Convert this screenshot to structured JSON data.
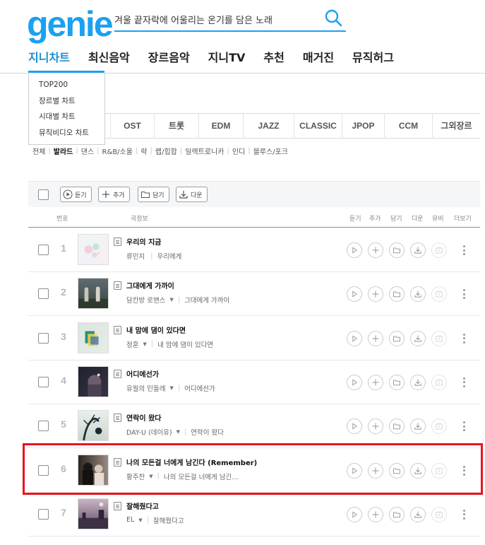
{
  "header": {
    "logo": "genie",
    "search": {
      "value": "겨울 끝자락에 어울리는 온기를 담은 노래",
      "placeholder": ""
    }
  },
  "gnb": [
    "지니차트",
    "최신음악",
    "장르음악",
    "지니TV",
    "추천",
    "매거진",
    "뮤직허그"
  ],
  "dropdown": [
    "TOP200",
    "장르별 차트",
    "시대별 차트",
    "뮤직비디오 차트"
  ],
  "genre_tabs": [
    "OST",
    "트롯",
    "EDM",
    "JAZZ",
    "CLASSIC",
    "JPOP",
    "CCM",
    "그외장르"
  ],
  "sub_genres": [
    "전체",
    "발라드",
    "댄스",
    "R&B/소울",
    "락",
    "랩/힙합",
    "일렉트로니카",
    "인디",
    "블루스/포크"
  ],
  "sub_genres_active": "발라드",
  "toolbar": {
    "play": "듣기",
    "add": "추가",
    "save": "담기",
    "download": "다운"
  },
  "list_header": {
    "rank": "번호",
    "info": "곡정보",
    "listen": "듣기",
    "add": "추가",
    "save": "담기",
    "download": "다운",
    "mv": "뮤비",
    "more": "더보기"
  },
  "songs": [
    {
      "rank": "1",
      "title": "우리의 지금",
      "artist": "류민지",
      "album": "우리에게",
      "has_menu": false
    },
    {
      "rank": "2",
      "title": "그대에게 가까이",
      "artist": "담칸방 로맨스",
      "album": "그대에게 가까이",
      "has_menu": true
    },
    {
      "rank": "3",
      "title": "내 맘에 댐이 있다면",
      "artist": "정훈",
      "album": "내 맘에 댐이 있다면",
      "has_menu": true
    },
    {
      "rank": "4",
      "title": "어디에선가",
      "artist": "유월의 민들레",
      "album": "어디에선가",
      "has_menu": true
    },
    {
      "rank": "5",
      "title": "연락이 왔다",
      "artist": "DAY-U (데이유)",
      "album": "연락이 왔다",
      "has_menu": true
    },
    {
      "rank": "6",
      "title": "나의 모든걸 너에게 남긴다 (Remember)",
      "artist": "황주찬",
      "album": "나의 모든걸 너에게 남긴…",
      "has_menu": true
    },
    {
      "rank": "7",
      "title": "잘해줬다고",
      "artist": "EL",
      "album": "잘해줬다고",
      "has_menu": true
    }
  ],
  "colors": {
    "brand": "#1aa1f0",
    "highlight": "#e8151d"
  }
}
